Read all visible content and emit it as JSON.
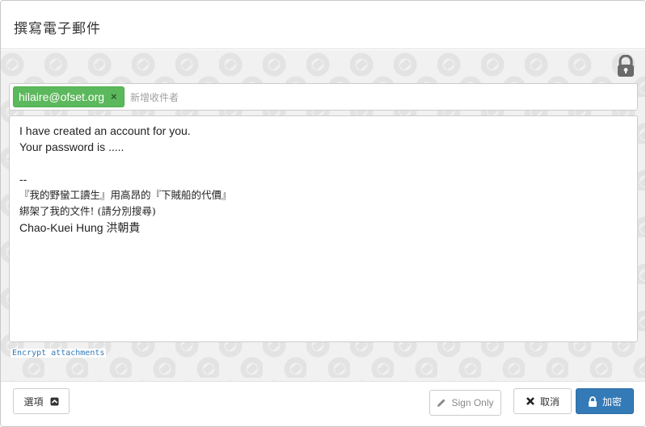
{
  "dialog": {
    "title": "撰寫電子郵件"
  },
  "recipients": {
    "chips": [
      {
        "email": "hilaire@ofset.org",
        "remove_glyph": "×"
      }
    ],
    "placeholder": "新增收件者"
  },
  "editor": {
    "lines": [
      "I have created an account for you.",
      "Your password is .....",
      "",
      "--",
      "『我的野蠻工讀生』用高昂的『下賊船的代價』",
      "綁架了我的文件! (請分別搜尋)",
      "Chao-Kuei Hung 洪朝貴"
    ]
  },
  "attachments": {
    "link_label": "Encrypt attachments"
  },
  "footer": {
    "options_label": "選項",
    "sign_only_label": "Sign Only",
    "cancel_label": "取消",
    "encrypt_label": "加密"
  },
  "icons": {
    "lock": "lock-icon",
    "options_toggle": "chevron-up-square-icon",
    "sign": "pencil-icon",
    "cancel": "close-icon",
    "encrypt": "lock-icon"
  },
  "colors": {
    "chip_bg": "#5cb85c",
    "primary": "#337ab7",
    "pattern_bg": "#f1f1f1",
    "link": "#337ab7"
  }
}
